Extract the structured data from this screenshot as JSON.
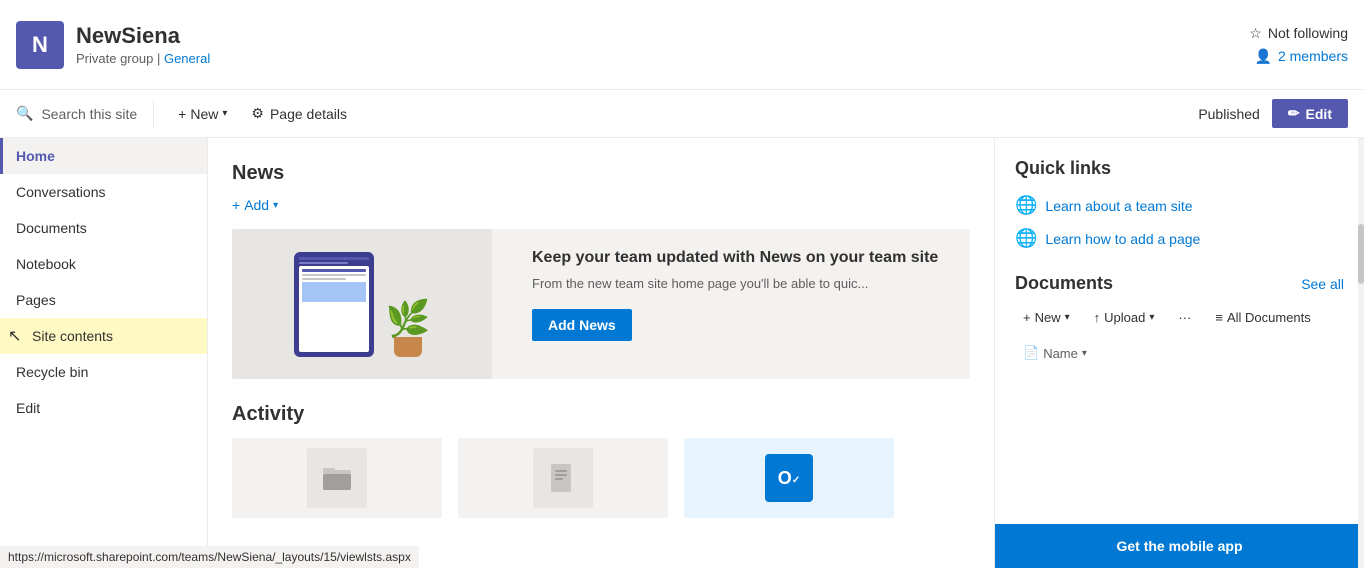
{
  "site": {
    "icon_letter": "N",
    "title": "NewSiena",
    "subtitle_group": "Private group",
    "subtitle_sep": "|",
    "subtitle_channel": "General"
  },
  "top_right": {
    "not_following_label": "Not following",
    "members_label": "2 members"
  },
  "toolbar": {
    "search_placeholder": "Search this site",
    "new_label": "New",
    "page_details_label": "Page details",
    "published_label": "Published",
    "edit_label": "Edit"
  },
  "sidebar": {
    "items": [
      {
        "label": "Home",
        "active": true
      },
      {
        "label": "Conversations",
        "active": false
      },
      {
        "label": "Documents",
        "active": false
      },
      {
        "label": "Notebook",
        "active": false
      },
      {
        "label": "Pages",
        "active": false
      },
      {
        "label": "Site contents",
        "active": false,
        "highlighted": true
      },
      {
        "label": "Recycle bin",
        "active": false
      },
      {
        "label": "Edit",
        "active": false
      }
    ]
  },
  "news": {
    "title": "News",
    "add_label": "Add",
    "heading": "Keep your team updated with News on your team site",
    "description": "From the new team site home page you'll be able to quic...",
    "add_news_label": "Add News"
  },
  "activity": {
    "title": "Activity"
  },
  "quick_links": {
    "title": "Quick links",
    "links": [
      {
        "label": "Learn about a team site"
      },
      {
        "label": "Learn how to add a page"
      }
    ]
  },
  "documents": {
    "title": "Documents",
    "see_all_label": "See all",
    "new_label": "New",
    "upload_label": "Upload",
    "more_label": "···",
    "all_docs_label": "All Documents",
    "name_col": "Name"
  },
  "mobile_banner": {
    "label": "Get the mobile app"
  },
  "status_bar": {
    "url": "https://microsoft.sharepoint.com/teams/NewSiena/_layouts/15/viewlsts.aspx"
  }
}
